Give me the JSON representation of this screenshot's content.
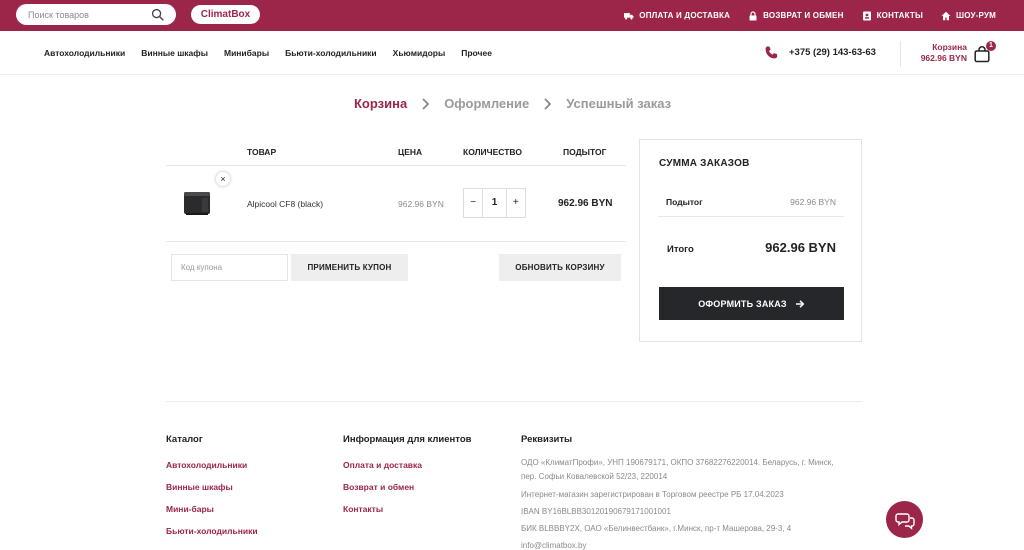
{
  "topbar": {
    "search_placeholder": "Поиск товаров",
    "logo": "ClimatBox",
    "links": [
      {
        "icon": "truck-icon",
        "label": "ОПЛАТА И ДОСТАВКА"
      },
      {
        "icon": "lock-icon",
        "label": "ВОЗВРАТ И ОБМЕН"
      },
      {
        "icon": "contact-card-icon",
        "label": "КОНТАКТЫ"
      },
      {
        "icon": "home-icon",
        "label": "ШОУ-РУМ"
      }
    ]
  },
  "nav": {
    "items": [
      "Автохолодильники",
      "Винные шкафы",
      "Минибары",
      "Бьюти-холодильники",
      "Хьюмидоры",
      "Прочее"
    ],
    "phone": "+375 (29) 143-63-63",
    "cart_label": "Корзина",
    "cart_total": "962.96 BYN",
    "cart_count": "1"
  },
  "steps": [
    "Корзина",
    "Оформление",
    "Успешный заказ"
  ],
  "cart": {
    "headers": {
      "product": "ТОВАР",
      "price": "ЦЕНА",
      "quantity": "КОЛИЧЕСТВО",
      "subtotal": "ПОДЫТОГ"
    },
    "item": {
      "remove": "×",
      "name": "Alpicool CF8 (black)",
      "price": "962.96 BYN",
      "minus": "−",
      "qty": "1",
      "plus": "+",
      "subtotal": "962.96 BYN"
    },
    "coupon_placeholder": "Код купона",
    "apply_coupon": "ПРИМЕНИТЬ КУПОН",
    "update_cart": "ОБНОВИТЬ КОРЗИНУ"
  },
  "summary": {
    "title": "СУММА ЗАКАЗОВ",
    "subtotal_label": "Подытог",
    "subtotal_value": "962.96 BYN",
    "total_label": "Итого",
    "total_value": "962.96 BYN",
    "checkout": "ОФОРМИТЬ ЗАКАЗ"
  },
  "footer": {
    "catalog_title": "Каталог",
    "catalog_links": [
      "Автохолодильники",
      "Винные шкафы",
      "Мини-бары",
      "Бьюти-холодильники"
    ],
    "info_title": "Информация для клиентов",
    "info_links": [
      "Оплата и доставка",
      "Возврат и обмен",
      "Контакты"
    ],
    "req_title": "Реквизиты",
    "req_lines": [
      "ОДО «КлиматПрофи», УНП 190679171, ОКПО 37682276220014. Беларусь, г. Минск,",
      "пер. Софьи Ковалевской 52/23, 220014",
      "Интернет-магазин зарегистрирован в Торговом реестре РБ 17.04.2023",
      "IBAN BY16BLBB30120190679171001001",
      "БИК BLBBBY2X, ОАО «Белинвестбанк», г.Минск, пр-т Машерова, 29-3, 4",
      "info@climatbox.by"
    ]
  },
  "colors": {
    "brand": "#9b2649",
    "dark": "#26272b",
    "muted": "#8c8c8c"
  }
}
